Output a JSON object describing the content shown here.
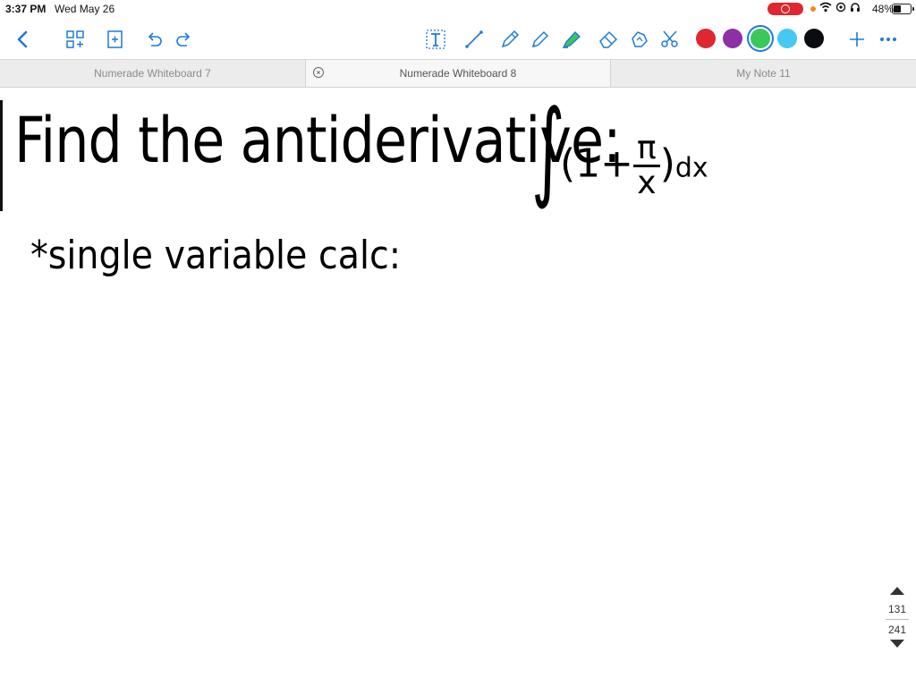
{
  "status_bar": {
    "time": "3:37 PM",
    "date": "Wed May 26",
    "battery_percent": "48%",
    "battery_level": 0.48
  },
  "toolbar": {
    "icons": [
      "back-chevron-icon",
      "thumbnails-icon",
      "add-page-icon",
      "undo-icon",
      "redo-icon",
      "text-tool-icon",
      "lasso-line-icon",
      "pen-icon",
      "pencil-icon",
      "highlighter-icon",
      "eraser-icon",
      "shape-tool-icon",
      "scissors-icon",
      "add-icon",
      "more-icon"
    ],
    "colors": [
      "#e0262f",
      "#8e2fa6",
      "#3bc85a",
      "#45c9f2",
      "#0b0b12"
    ],
    "selected_color_index": 2
  },
  "tabs": [
    {
      "label": "Numerade Whiteboard 7",
      "active": false
    },
    {
      "label": "Numerade Whiteboard 8",
      "active": true
    },
    {
      "label": "My Note 11",
      "active": false
    }
  ],
  "canvas": {
    "line1": "Find the antiderivative:",
    "integral": "∫",
    "expr_open": "(1+",
    "frac_num": "π",
    "frac_den": "x",
    "expr_close": ")",
    "dx": "dx",
    "line2": "*single variable calc:"
  },
  "pager": {
    "current": "131",
    "total": "241"
  }
}
